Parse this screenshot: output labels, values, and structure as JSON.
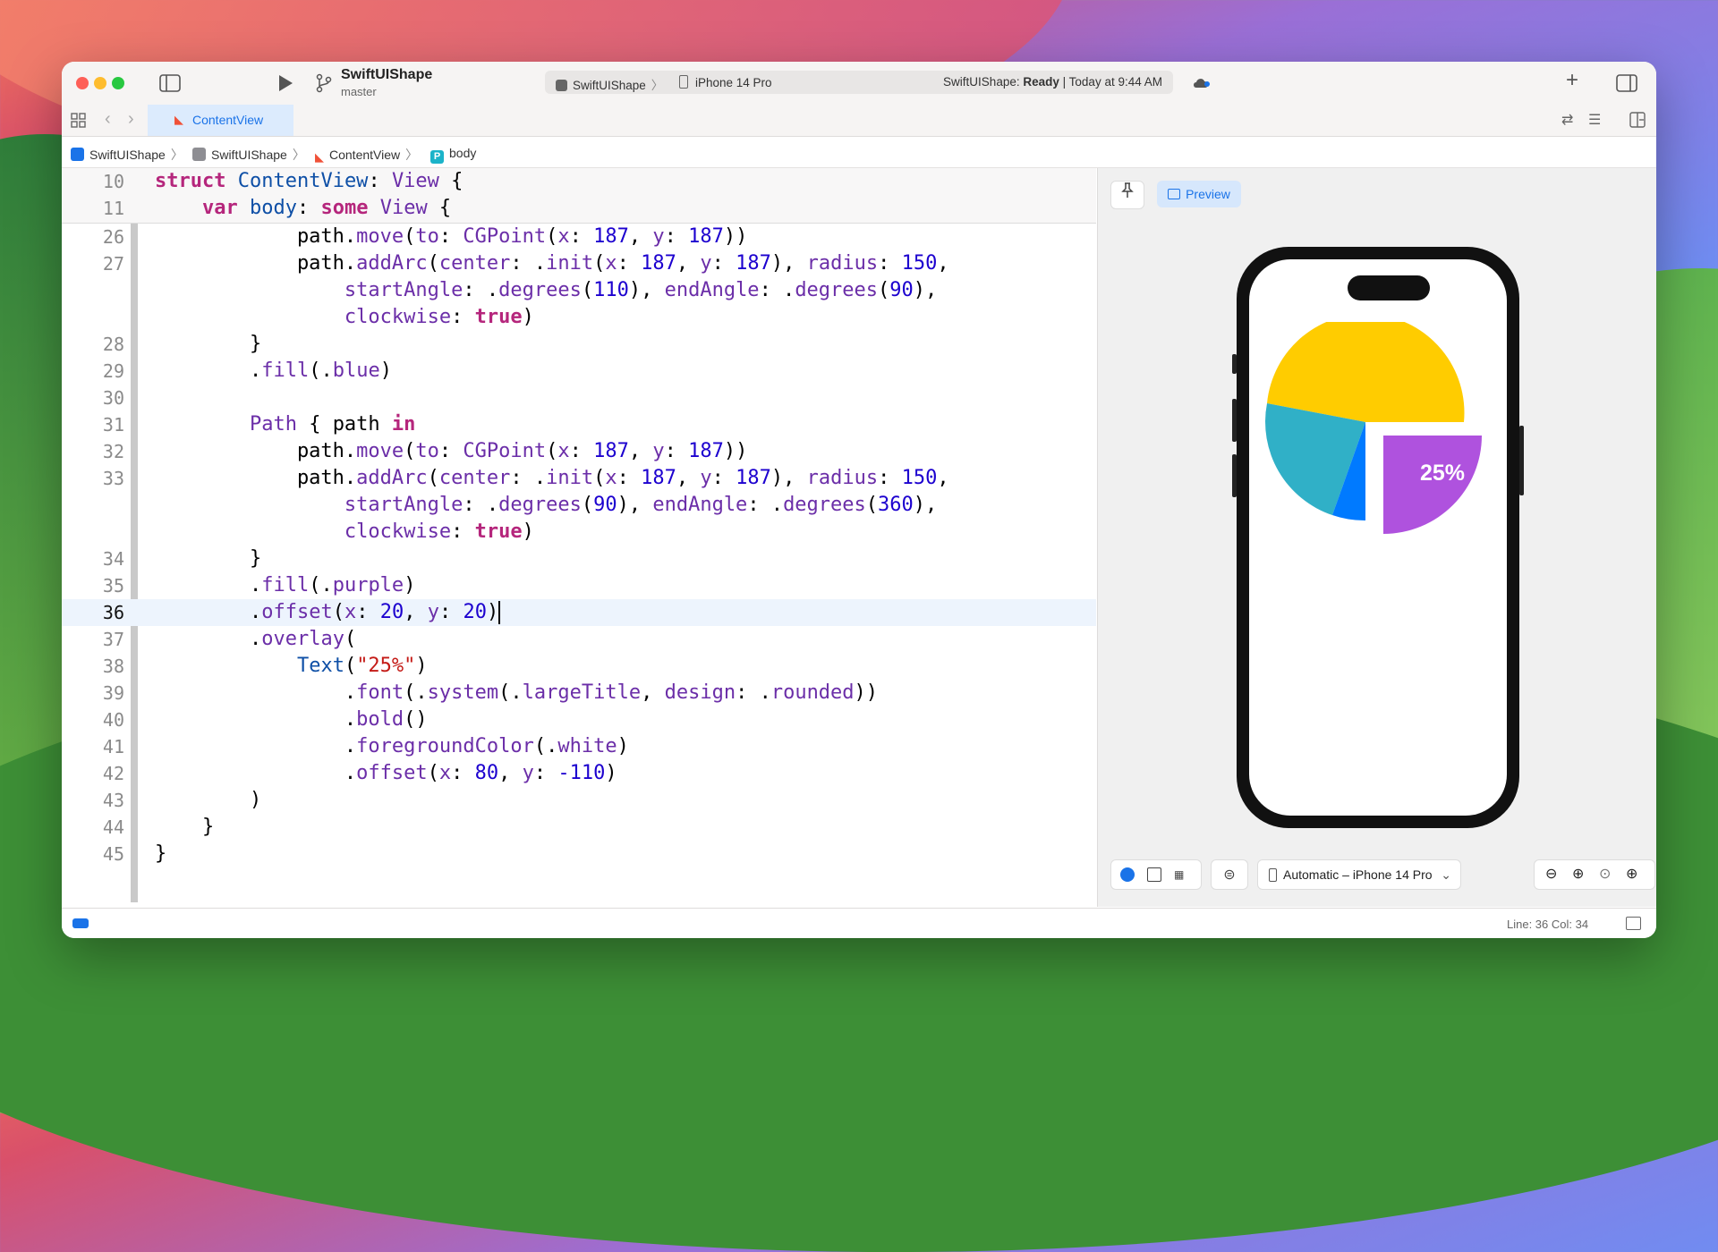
{
  "titlebar": {
    "project": "SwiftUIShape",
    "branch": "master",
    "scheme": "SwiftUIShape",
    "device": "iPhone 14 Pro",
    "status_project": "SwiftUIShape:",
    "status_state": "Ready",
    "status_time": "| Today at 9:44 AM"
  },
  "tabs": [
    {
      "label": "ContentView"
    }
  ],
  "breadcrumb": [
    "SwiftUIShape",
    "SwiftUIShape",
    "ContentView",
    "body"
  ],
  "breadcrumb_badge": "P",
  "editor": {
    "sticky": [
      {
        "num": "10"
      },
      {
        "num": "11"
      }
    ],
    "lines": [
      {
        "num": "26"
      },
      {
        "num": "27"
      },
      {
        "num": ""
      },
      {
        "num": ""
      },
      {
        "num": "28"
      },
      {
        "num": "29"
      },
      {
        "num": "30"
      },
      {
        "num": "31"
      },
      {
        "num": "32"
      },
      {
        "num": "33"
      },
      {
        "num": ""
      },
      {
        "num": ""
      },
      {
        "num": "34"
      },
      {
        "num": "35"
      },
      {
        "num": "36"
      },
      {
        "num": "37"
      },
      {
        "num": "38"
      },
      {
        "num": "39"
      },
      {
        "num": "40"
      },
      {
        "num": "41"
      },
      {
        "num": "42"
      },
      {
        "num": "43"
      },
      {
        "num": "44"
      },
      {
        "num": "45"
      }
    ]
  },
  "canvas": {
    "preview_label": "Preview",
    "pie_label": "25%",
    "device_menu": "Automatic – iPhone 14 Pro",
    "colors": {
      "yellow": "#ffcc00",
      "teal": "#30b0c7",
      "blue": "#007aff",
      "purple": "#af52de"
    }
  },
  "statusbar": {
    "position": "Line: 36  Col: 34"
  }
}
